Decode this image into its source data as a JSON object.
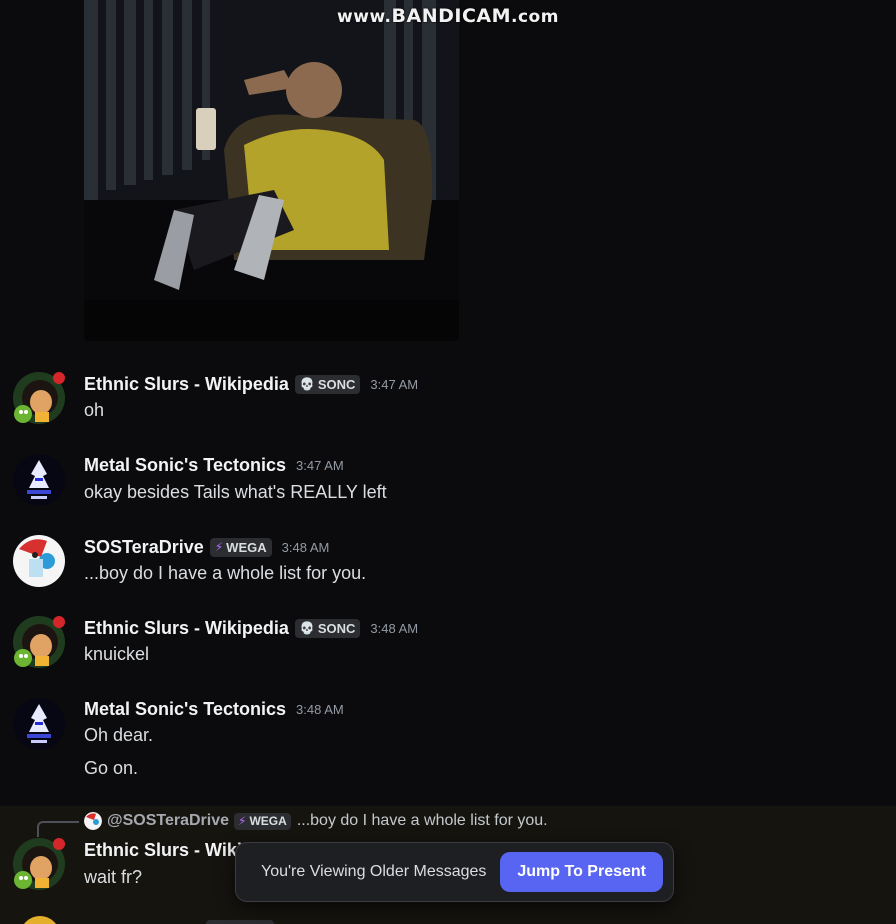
{
  "watermark": {
    "prefix": "www.",
    "brand": "BANDICAM",
    "suffix": ".com"
  },
  "messages": [
    {
      "avatar": "girl-with-plant-avatar",
      "username": "Ethnic Slurs - Wikipedia",
      "tag": {
        "icon": "skull-icon",
        "label": "SONC"
      },
      "timestamp": "3:47 AM",
      "lines": [
        "oh"
      ]
    },
    {
      "avatar": "metal-sonic-pixel-avatar",
      "username": "Metal Sonic's Tectonics",
      "timestamp": "3:47 AM",
      "lines": [
        "okay besides Tails what's REALLY left"
      ]
    },
    {
      "avatar": "cartoon-character-avatar",
      "username": "SOSTeraDrive",
      "tag": {
        "icon": "lightning-icon",
        "label": "WEGA"
      },
      "timestamp": "3:48 AM",
      "lines": [
        "...boy do I have a whole list for you."
      ]
    },
    {
      "avatar": "girl-with-plant-avatar",
      "username": "Ethnic Slurs - Wikipedia",
      "tag": {
        "icon": "skull-icon",
        "label": "SONC"
      },
      "timestamp": "3:48 AM",
      "lines": [
        "knuickel"
      ]
    },
    {
      "avatar": "metal-sonic-pixel-avatar",
      "username": "Metal Sonic's Tectonics",
      "timestamp": "3:48 AM",
      "lines": [
        "Oh dear.",
        "Go on."
      ]
    },
    {
      "avatar": "girl-with-plant-avatar",
      "username": "Ethnic Slurs - Wiki",
      "lines": [
        "wait fr?"
      ],
      "reply": {
        "username": "@SOSTeraDrive",
        "tag": {
          "icon": "lightning-icon",
          "label": "WEGA"
        },
        "text": "...boy do I have a whole list for you."
      }
    }
  ],
  "older_bar": {
    "text": "You're Viewing Older Messages",
    "button": "Jump To Present"
  },
  "colors": {
    "accent": "#5865f2",
    "background": "#0b0b0d",
    "username": "#f2f3f5",
    "timestamp": "#949ba4"
  }
}
